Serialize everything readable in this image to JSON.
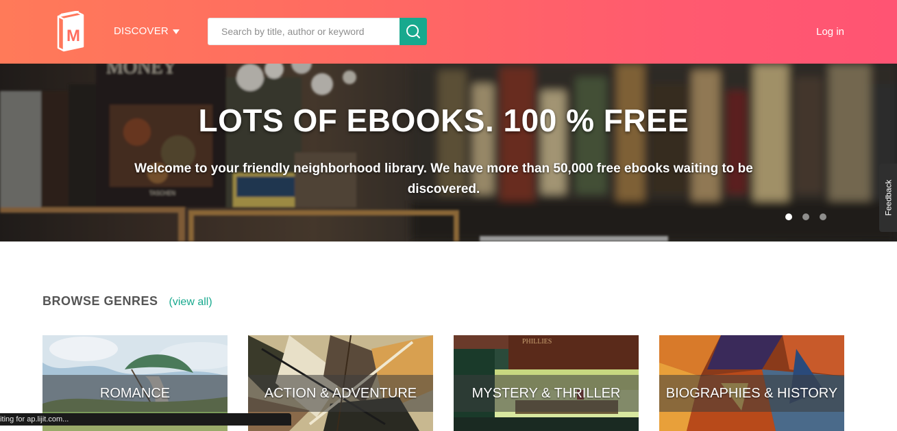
{
  "header": {
    "logo_icon": "book-m-icon",
    "discover_label": "DISCOVER",
    "search_placeholder": "Search by title, author or keyword",
    "search_icon": "search-icon",
    "login_label": "Log in",
    "colors": {
      "gradient_start": "#ff7a59",
      "gradient_end": "#ff5473",
      "search_button": "#18a98e"
    }
  },
  "hero": {
    "title": "LOTS OF EBOOKS. 100 % FREE",
    "subtitle": "Welcome to your friendly neighborhood library. We have more than 50,000 free ebooks waiting to be discovered.",
    "slides": 3,
    "active_slide": 1
  },
  "feedback_label": "Feedback",
  "genres": {
    "title": "BROWSE GENRES",
    "view_all": "(view all)",
    "items": [
      {
        "label": "ROMANCE"
      },
      {
        "label": "ACTION & ADVENTURE"
      },
      {
        "label": "MYSTERY & THRILLER"
      },
      {
        "label": "BIOGRAPHIES & HISTORY"
      }
    ]
  },
  "status_bar": "Waiting for ap.lijit.com..."
}
